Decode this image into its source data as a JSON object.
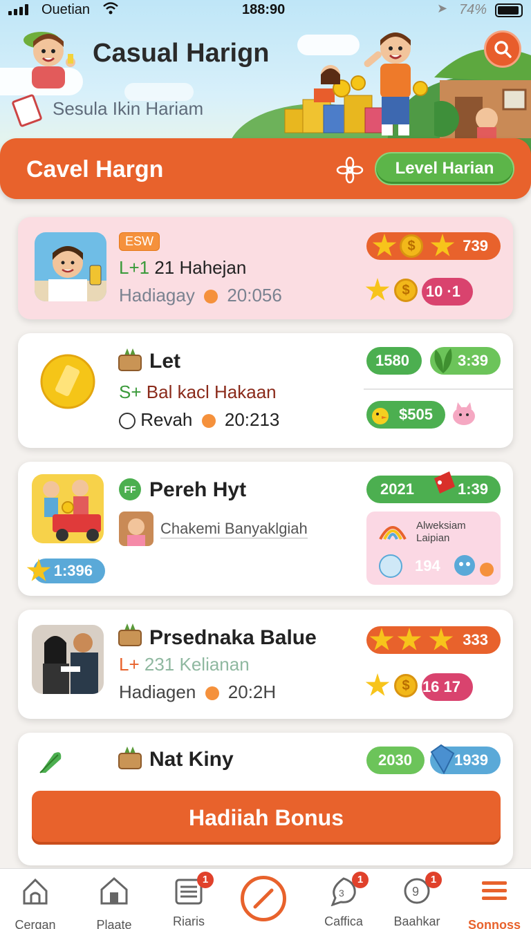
{
  "status_bar": {
    "carrier": "Ouetian",
    "time": "188:90",
    "battery": "74%"
  },
  "header": {
    "title": "Casual Harign",
    "subtitle": "Sesula Ikin Hariam"
  },
  "banner": {
    "title": "Cavel Hargn",
    "level_button": "Level Harian"
  },
  "cards": [
    {
      "tag": "ESW",
      "line1_prefix": "L+1",
      "line1": "21 Hahejan",
      "line2_label": "Hadiagay",
      "line2_value": "20:056",
      "pill_top": "739",
      "pill_bottom": "10 ·1"
    },
    {
      "title": "Let",
      "line1_prefix": "S+",
      "line1": "Bal kacl Hakaan",
      "line2_label": "Revah",
      "line2_value": "20:213",
      "pill_a": "1580",
      "pill_b": "3:39",
      "pill_c": "$505"
    },
    {
      "title": "Pereh Hyt",
      "title_badge": "FF",
      "person_text": "Chakemi Banyaklgiah",
      "bottom_pill": "1:396",
      "pill_a": "2021",
      "pill_b": "1:39",
      "sub_panel_title": "Alweksiam",
      "sub_panel_sub": "Laipian",
      "sub_panel_value": "194"
    },
    {
      "title": "Prsednaka Balue",
      "line1_prefix": "L+",
      "line1": "231 Kelianan",
      "line2_label": "Hadiagen",
      "line2_value": "20:2H",
      "pill_top": "333",
      "pill_bottom": "16 17"
    },
    {
      "title": "Nat Kiny",
      "pill_a": "2030",
      "pill_b": "1939",
      "bonus_button": "Hadiiah Bonus"
    }
  ],
  "nav": [
    {
      "label": "Cergan",
      "icon": "home-outline-icon"
    },
    {
      "label": "Plaate",
      "icon": "house-icon"
    },
    {
      "label": "Riaris",
      "icon": "list-icon",
      "badge": "1"
    },
    {
      "label": "",
      "icon": "compass-center-icon"
    },
    {
      "label": "Caffica",
      "icon": "chat-icon",
      "badge": "1"
    },
    {
      "label": "Baahkar",
      "icon": "gift-icon",
      "badge": "1"
    },
    {
      "label": "Sonnoss",
      "icon": "menu-icon",
      "active": true
    }
  ],
  "colors": {
    "accent": "#e8622c",
    "green": "#5cb549",
    "pink": "#d9436e",
    "blue": "#5aa9d8"
  }
}
